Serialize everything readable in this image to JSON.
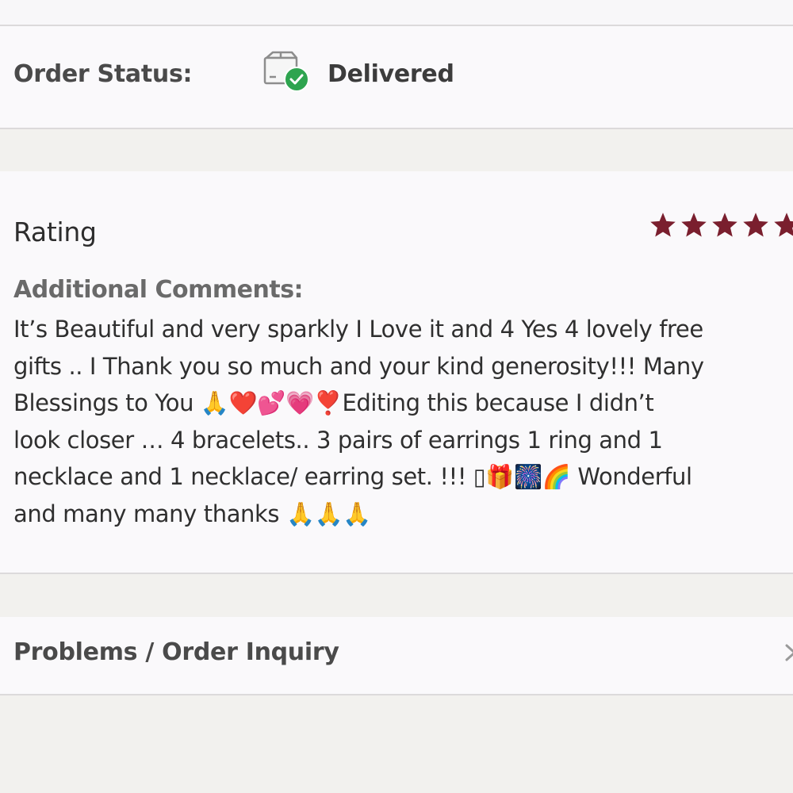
{
  "order_status": {
    "label": "Order Status:",
    "icon": "package-delivered-icon",
    "value": "Delivered",
    "check_color": "#2ea44f"
  },
  "rating": {
    "label": "Rating",
    "stars": 5,
    "max_stars": 5,
    "star_color": "#7a1f2e"
  },
  "comments": {
    "label": "Additional Comments:",
    "text": "It’s Beautiful and very sparkly I Love it and 4 Yes 4 lovely free\ngifts .. I Thank you so much and your kind generosity!!! Many\nBlessings to You 🙏❤️💕💗❣️Editing this because I didn’t\nlook closer … 4 bracelets.. 3 pairs of earrings 1 ring and 1\nnecklace and 1 necklace/ earring set. !!! ▯🎁🎆🌈 Wonderful\nand many many thanks 🙏🙏🙏"
  },
  "problems": {
    "label": "Problems / Order Inquiry",
    "icon": "chevron-right-icon"
  }
}
